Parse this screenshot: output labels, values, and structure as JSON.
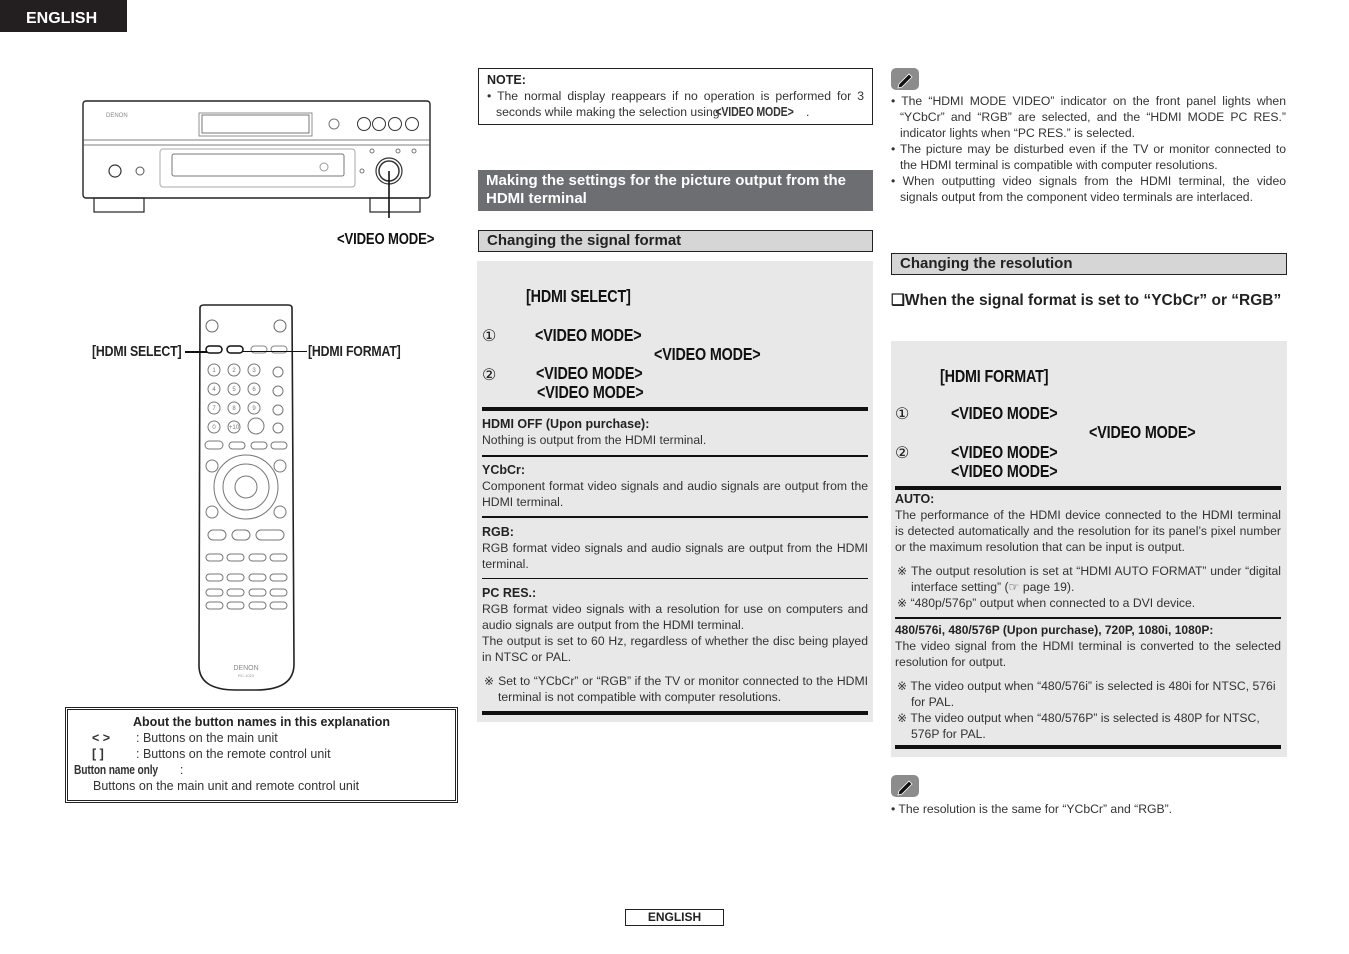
{
  "page": {
    "language_tab": "ENGLISH",
    "footer_label": "ENGLISH"
  },
  "figure_main_unit": {
    "brand": "DENON",
    "callout": "<VIDEO MODE>"
  },
  "figure_remote": {
    "brand": "DENON",
    "model": "RC-1023",
    "callout_left": "[HDMI SELECT]",
    "callout_right": "[HDMI FORMAT]",
    "keys": [
      "1",
      "2",
      "3",
      "4",
      "5",
      "6",
      "7",
      "8",
      "9",
      "0",
      "+10"
    ]
  },
  "explanation_box": {
    "title": "About the button names in this explanation",
    "rows": [
      {
        "symbol": "<   >",
        "text": ": Buttons on the main unit"
      },
      {
        "symbol": "[    ]",
        "text": ": Buttons on the remote control unit"
      }
    ],
    "button_name_only_label": "Button name only",
    "button_name_only_colon": " :",
    "button_name_only_text": "Buttons on the main unit and remote control unit"
  },
  "note": {
    "heading": "NOTE:",
    "text_before": "The normal display reappears if no operation is performed for 3 seconds while making the selection using ",
    "text_bold": "<VIDEO MODE>",
    "text_after": "."
  },
  "section": {
    "title": "Making the settings for the picture output from the HDMI terminal"
  },
  "signal_format": {
    "subheading": "Changing the signal format",
    "step0": "[HDMI SELECT]",
    "step1_num": "①",
    "step1_a": "<VIDEO MODE>",
    "step1_b": "<VIDEO MODE>",
    "step2_num": "②",
    "step2_a": "<VIDEO MODE>",
    "step2_b": "<VIDEO MODE>",
    "options": [
      {
        "heading": "HDMI OFF (Upon purchase):",
        "text": "Nothing is output from the HDMI terminal."
      },
      {
        "heading": "YCbCr:",
        "text": "Component format video signals and audio signals are output from the HDMI terminal."
      },
      {
        "heading": "RGB:",
        "text": "RGB format video signals and audio signals are output from the HDMI terminal."
      },
      {
        "heading": "PC RES.:",
        "text": "RGB format video signals with a resolution for use on computers and audio signals are output from the HDMI terminal.",
        "text2": "The output is set to 60 Hz, regardless of whether the disc being played in NTSC or PAL.",
        "note": "※ Set to “YCbCr” or “RGB” if the TV or monitor connected to the HDMI terminal is not compatible with computer resolutions."
      }
    ]
  },
  "memo1": {
    "icon": "pencil-icon",
    "bullets": [
      "• The “HDMI MODE VIDEO” indicator on the front panel lights when “YCbCr” and “RGB” are selected, and the “HDMI MODE PC RES.” indicator lights when “PC RES.” is selected.",
      "• The picture may be disturbed even if the TV or monitor connected to the HDMI terminal is compatible with computer resolutions.",
      "• When outputting video signals from the HDMI terminal, the video signals output from the component video terminals are interlaced."
    ]
  },
  "resolution": {
    "subheading": "Changing the resolution",
    "condition": "❑When the signal format is set to “YCbCr” or “RGB”",
    "step0": "[HDMI FORMAT]",
    "step1_num": "①",
    "step1_a": "<VIDEO MODE>",
    "step1_b": "<VIDEO MODE>",
    "step2_num": "②",
    "step2_a": "<VIDEO MODE>",
    "step2_b": "<VIDEO MODE>",
    "auto_heading": "AUTO:",
    "auto_text": "The performance of the HDMI device connected to the HDMI terminal is detected automatically and the resolution for its panel’s pixel number or the maximum resolution that can be input is output.",
    "auto_note1_before": "※ The output resolution is set at “HDMI AUTO FORMAT” under “digital interface setting” (",
    "auto_note1_icon": "☞",
    "auto_note1_after": " page 19).",
    "auto_note2": "※ “480p/576p” output when connected to a DVI device.",
    "fixed_heading": "480/576i, 480/576P (Upon purchase), 720P, 1080i, 1080P:",
    "fixed_text": "The video signal from the HDMI terminal is converted to the selected resolution for output.",
    "fixed_note1": "※ The video output when “480/576i” is selected is 480i for NTSC, 576i for PAL.",
    "fixed_note2": "※ The video output when “480/576P” is selected is 480P for NTSC, 576P for PAL."
  },
  "memo2": {
    "icon": "pencil-icon",
    "bullets": [
      "• The resolution is the same for “YCbCr” and “RGB”."
    ]
  }
}
